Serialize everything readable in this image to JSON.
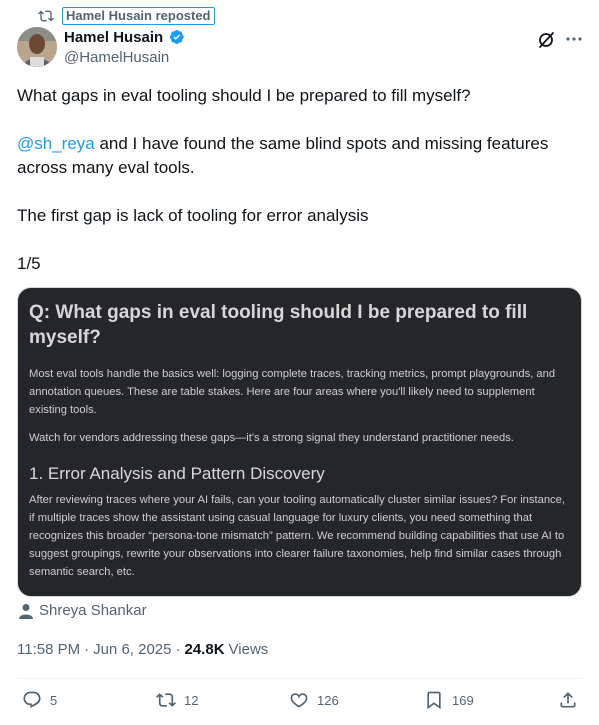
{
  "repost": {
    "label": "Hamel Husain reposted"
  },
  "author": {
    "name": "Hamel Husain",
    "handle": "@HamelHusain"
  },
  "tweet": {
    "line1": "What gaps in eval tooling should I be prepared to fill myself?",
    "mention": "@sh_reya",
    "line2_rest": " and I have found the same blind spots and missing features across many eval tools.",
    "line3": "The first gap is lack of tooling for error analysis",
    "line4": "1/5"
  },
  "media": {
    "title": "Q: What gaps in eval tooling should I be prepared to fill myself?",
    "para1": "Most eval tools handle the basics well: logging complete traces, tracking metrics, prompt playgrounds, and annotation queues. These are table stakes. Here are four areas where you'll likely need to supplement existing tools.",
    "para2": "Watch for vendors addressing these gaps—it's a strong signal they understand practitioner needs.",
    "heading": "1. Error Analysis and Pattern Discovery",
    "para3": "After reviewing traces where your AI fails, can your tooling automatically cluster similar issues? For instance, if multiple traces show the assistant using casual language for luxury clients, you need something that recognizes this broader “persona-tone mismatch” pattern. We recommend building capabilities that use AI to suggest groupings, rewrite your observations into clearer failure taxonomies, help find similar cases through semantic search, etc."
  },
  "tagged_user": "Shreya Shankar",
  "meta": {
    "time": "11:58 PM",
    "dot1": "·",
    "date": "Jun 6, 2025",
    "dot2": "·",
    "views_count": "24.8K",
    "views_label": "Views"
  },
  "actions": {
    "replies": "5",
    "reposts": "12",
    "likes": "126",
    "bookmarks": "169"
  },
  "colors": {
    "accent": "#1d9bf0",
    "secondary_text": "#536471",
    "media_bg": "#252629"
  }
}
